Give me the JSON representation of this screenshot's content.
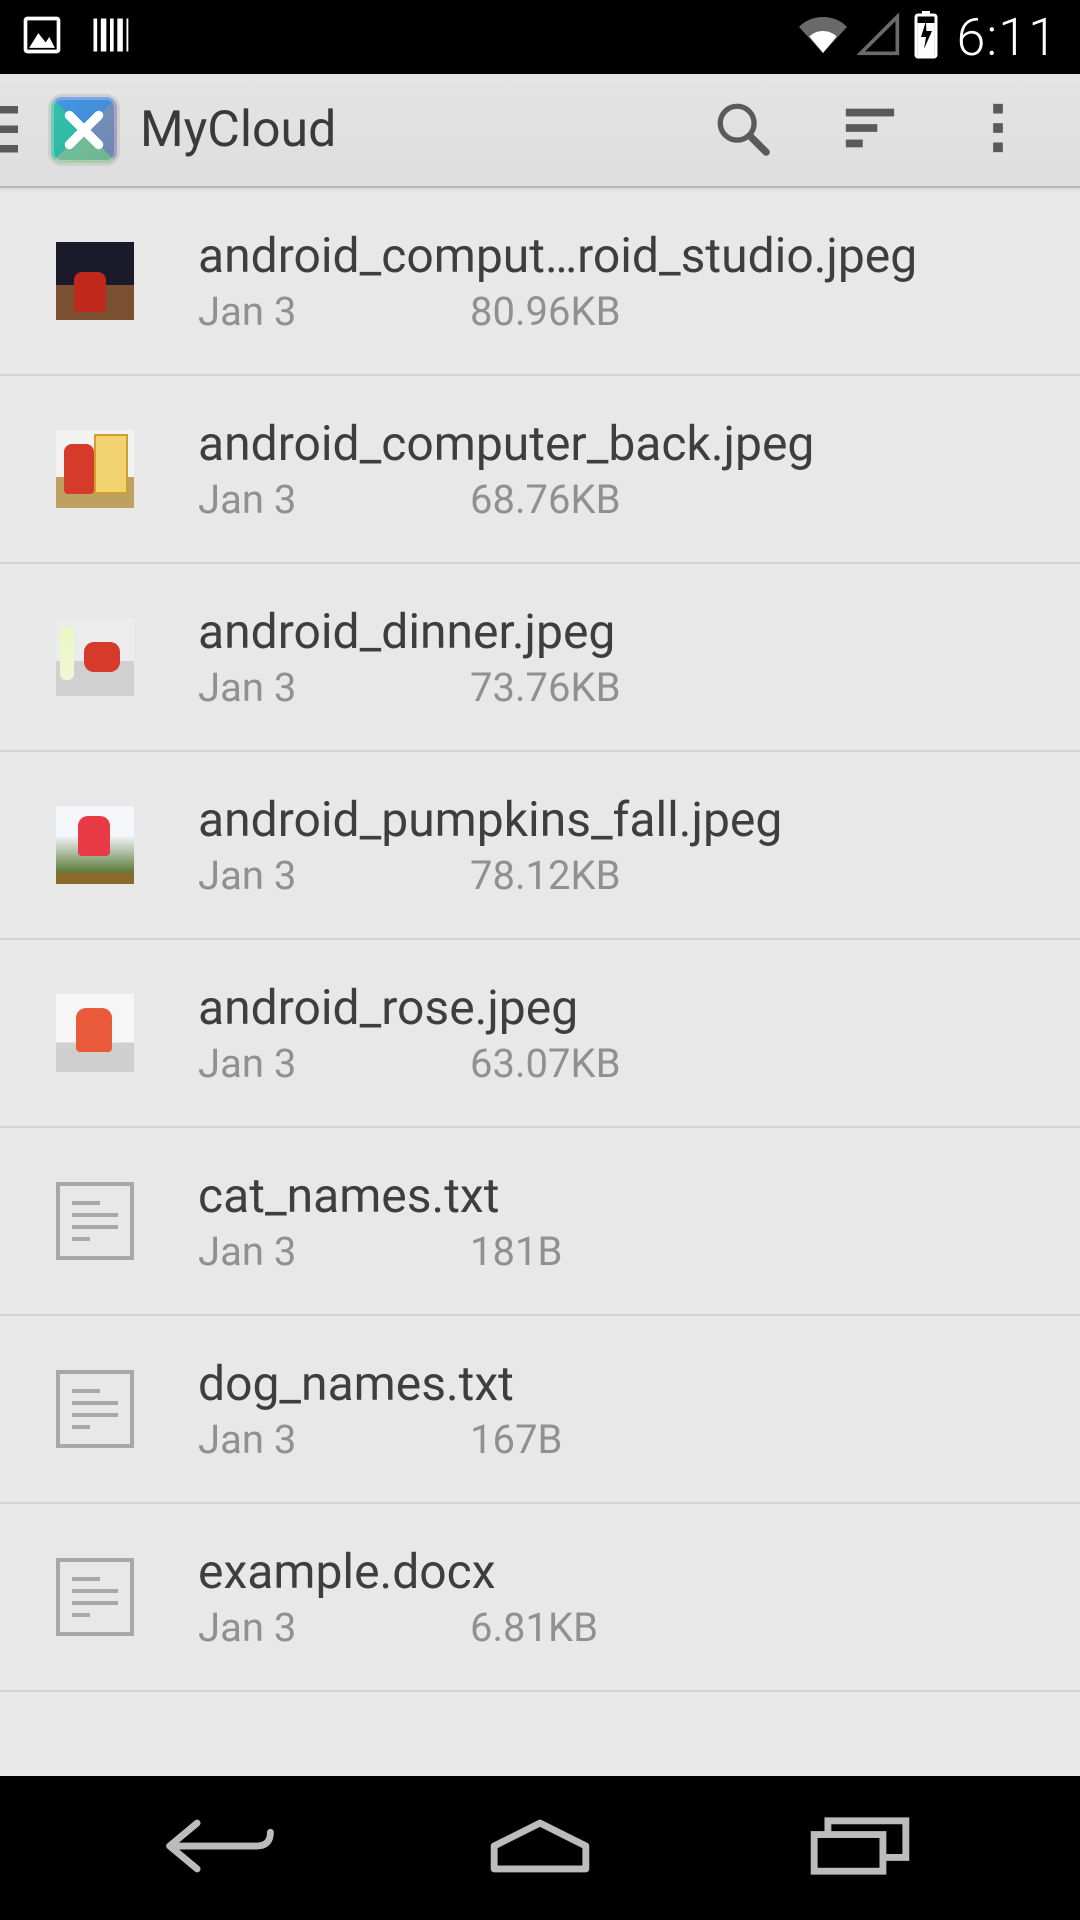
{
  "status": {
    "time": "6:11"
  },
  "toolbar": {
    "title": "MyCloud"
  },
  "files": [
    {
      "name": "android_comput…roid_studio.jpeg",
      "date": "Jan 3",
      "size": "80.96KB",
      "thumb": "image",
      "tclass": "th-1"
    },
    {
      "name": "android_computer_back.jpeg",
      "date": "Jan 3",
      "size": "68.76KB",
      "thumb": "image",
      "tclass": "th-2"
    },
    {
      "name": "android_dinner.jpeg",
      "date": "Jan 3",
      "size": "73.76KB",
      "thumb": "image",
      "tclass": "th-3"
    },
    {
      "name": "android_pumpkins_fall.jpeg",
      "date": "Jan 3",
      "size": "78.12KB",
      "thumb": "image",
      "tclass": "th-4"
    },
    {
      "name": "android_rose.jpeg",
      "date": "Jan 3",
      "size": "63.07KB",
      "thumb": "image",
      "tclass": "th-5"
    },
    {
      "name": "cat_names.txt",
      "date": "Jan 3",
      "size": "181B",
      "thumb": "doc"
    },
    {
      "name": "dog_names.txt",
      "date": "Jan 3",
      "size": "167B",
      "thumb": "doc"
    },
    {
      "name": "example.docx",
      "date": "Jan 3",
      "size": "6.81KB",
      "thumb": "doc"
    }
  ]
}
